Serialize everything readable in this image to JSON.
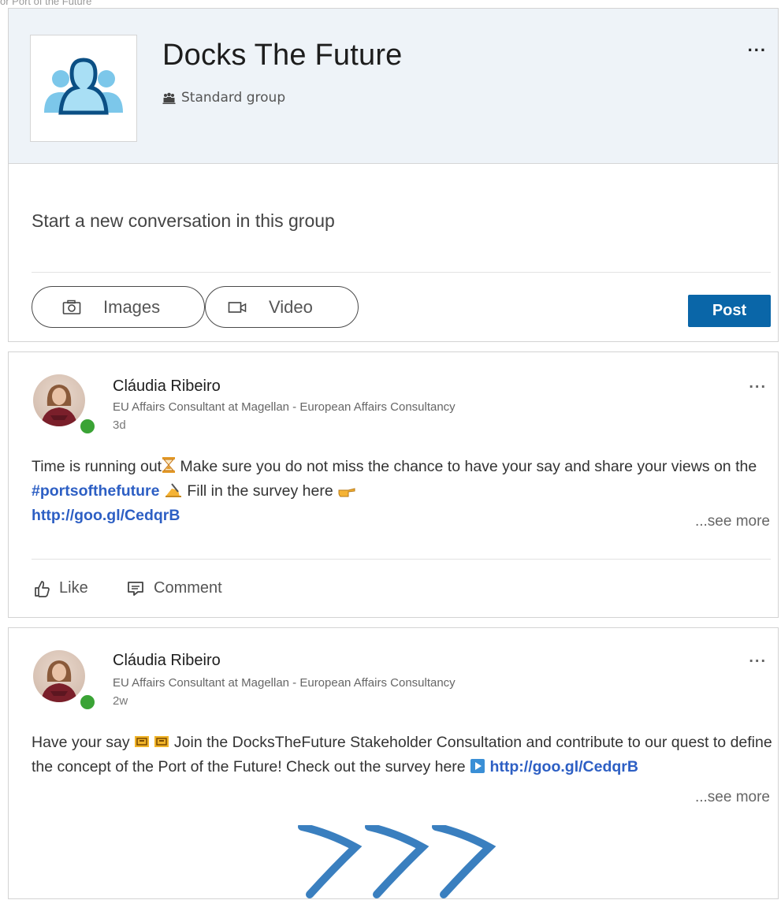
{
  "breadcrumb": "or Port of the Future",
  "group": {
    "name": "Docks The Future",
    "type": "Standard group",
    "menu": "..."
  },
  "composer": {
    "prompt": "Start a new conversation in this group",
    "images_label": "Images",
    "video_label": "Video",
    "post_label": "Post"
  },
  "posts": [
    {
      "author": "Cláudia Ribeiro",
      "headline": "EU Affairs Consultant at Magellan - European Affairs Consultancy",
      "time": "3d",
      "text_a": "Time is running out",
      "text_b": " Make sure you do not miss the chance to have your say and share your views on the ",
      "hashtag": "#portsofthefuture",
      "text_c": " Fill in the survey here ",
      "link": "http://goo.gl/CedqrB",
      "see_more": "...see more",
      "like_label": "Like",
      "comment_label": "Comment",
      "menu": "..."
    },
    {
      "author": "Cláudia Ribeiro",
      "headline": "EU Affairs Consultant at Magellan - European Affairs Consultancy",
      "time": "2w",
      "text_a": "Have your say ",
      "text_b": " Join the DocksTheFuture Stakeholder Consultation and contribute to our quest to define the concept of the Port of the Future! Check out the survey here ",
      "link": "http://goo.gl/CedqrB",
      "see_more": "...see more",
      "menu": "..."
    }
  ]
}
